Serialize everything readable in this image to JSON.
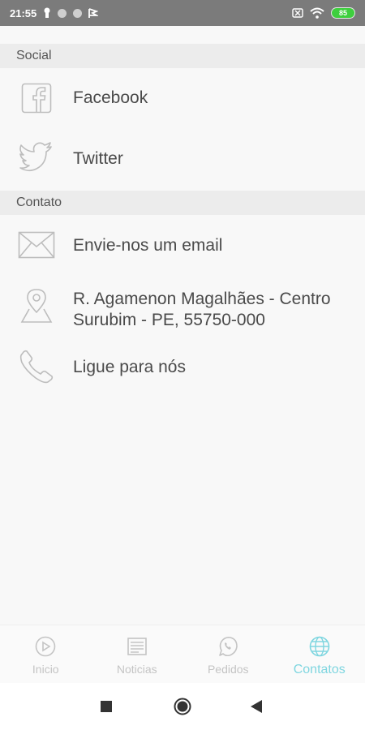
{
  "status_bar": {
    "time": "21:55",
    "battery": "85",
    "icons": [
      "keyhole-icon",
      "circle-icon",
      "circle-icon",
      "flag-icon",
      "sim-off-icon",
      "wifi-icon",
      "battery-icon"
    ]
  },
  "sections": {
    "social": {
      "title": "Social",
      "items": [
        {
          "label": "Facebook",
          "icon": "facebook-icon"
        },
        {
          "label": "Twitter",
          "icon": "twitter-icon"
        }
      ]
    },
    "contato": {
      "title": "Contato",
      "items": [
        {
          "label": "Envie-nos um email",
          "icon": "envelope-icon"
        },
        {
          "label_line1": "R. Agamenon Magalhães - Centro",
          "label_line2": "Surubim - PE, 55750-000",
          "icon": "map-pin-icon"
        },
        {
          "label": "Ligue para nós",
          "icon": "phone-icon"
        }
      ]
    }
  },
  "bottom_nav": {
    "items": [
      {
        "label": "Inicio",
        "icon": "play-circle-icon",
        "active": false
      },
      {
        "label": "Noticias",
        "icon": "newspaper-icon",
        "active": false
      },
      {
        "label": "Pedidos",
        "icon": "whatsapp-icon",
        "active": false
      },
      {
        "label": "Contatos",
        "icon": "globe-icon",
        "active": true
      }
    ]
  },
  "colors": {
    "active": "#7fd6e0",
    "inactive": "#c4c4c4",
    "status_bar": "#7b7b7b",
    "section_header": "#ececec"
  }
}
